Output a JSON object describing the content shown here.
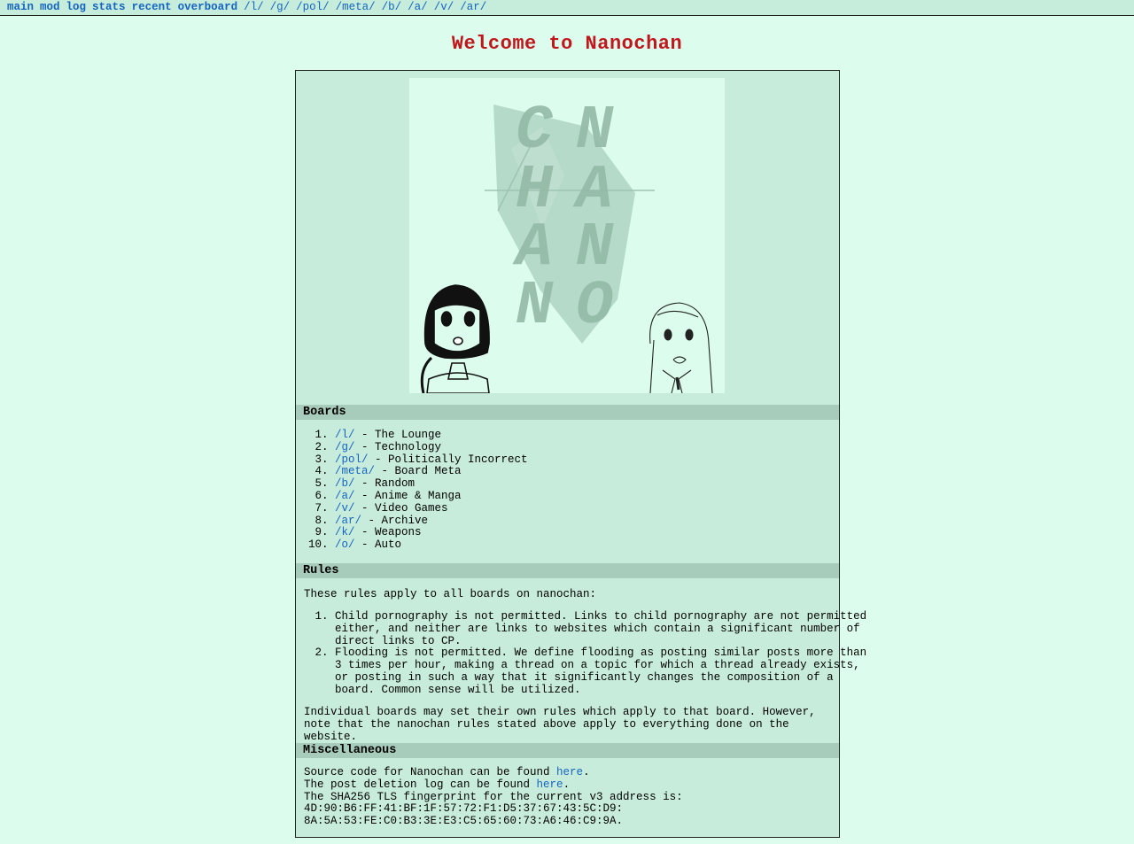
{
  "nav": {
    "primary": [
      "main",
      "mod",
      "log",
      "stats",
      "recent",
      "overboard"
    ],
    "boards": [
      "/l/",
      "/g/",
      "/pol/",
      "/meta/",
      "/b/",
      "/a/",
      "/v/",
      "/ar/"
    ]
  },
  "page_title": "Welcome to Nanochan",
  "banner": {
    "letters": [
      "C",
      "N",
      "H",
      "A",
      "A",
      "N",
      "N",
      "O"
    ]
  },
  "boards_section": {
    "heading": "Boards",
    "items": [
      {
        "link": "/l/",
        "desc": " - The Lounge"
      },
      {
        "link": "/g/",
        "desc": " - Technology"
      },
      {
        "link": "/pol/",
        "desc": " - Politically Incorrect"
      },
      {
        "link": "/meta/",
        "desc": " - Board Meta"
      },
      {
        "link": "/b/",
        "desc": " - Random"
      },
      {
        "link": "/a/",
        "desc": " - Anime & Manga"
      },
      {
        "link": "/v/",
        "desc": " - Video Games"
      },
      {
        "link": "/ar/",
        "desc": " - Archive"
      },
      {
        "link": "/k/",
        "desc": " - Weapons"
      },
      {
        "link": "/o/",
        "desc": " - Auto"
      }
    ]
  },
  "rules_section": {
    "heading": "Rules",
    "intro": "These rules apply to all boards on nanochan:",
    "rules": [
      "Child pornography is not permitted. Links to child pornography are not permitted either, and neither are links to websites which contain a significant number of direct links to CP.",
      "Flooding is not permitted. We define flooding as posting similar posts more than 3 times per hour, making a thread on a topic for which a thread already exists, or posting in such a way that it significantly changes the composition of a board. Common sense will be utilized."
    ],
    "outro": "Individual boards may set their own rules which apply to that board. However, note that the nanochan rules stated above apply to everything done on the website."
  },
  "misc_section": {
    "heading": "Miscellaneous",
    "source_prefix": "Source code for Nanochan can be found ",
    "source_link": "here",
    "source_suffix": ".",
    "log_prefix": "The post deletion log can be found ",
    "log_link": "here",
    "log_suffix": ".",
    "fingerprint_label": "The SHA256 TLS fingerprint for the current v3 address is:",
    "fingerprint_line1": "4D:90:B6:FF:41:BF:1F:57:72:F1:D5:37:67:43:5C:D9:",
    "fingerprint_line2": "8A:5A:53:FE:C0:B3:3E:E3:C5:65:60:73:A6:46:C9:9A."
  }
}
